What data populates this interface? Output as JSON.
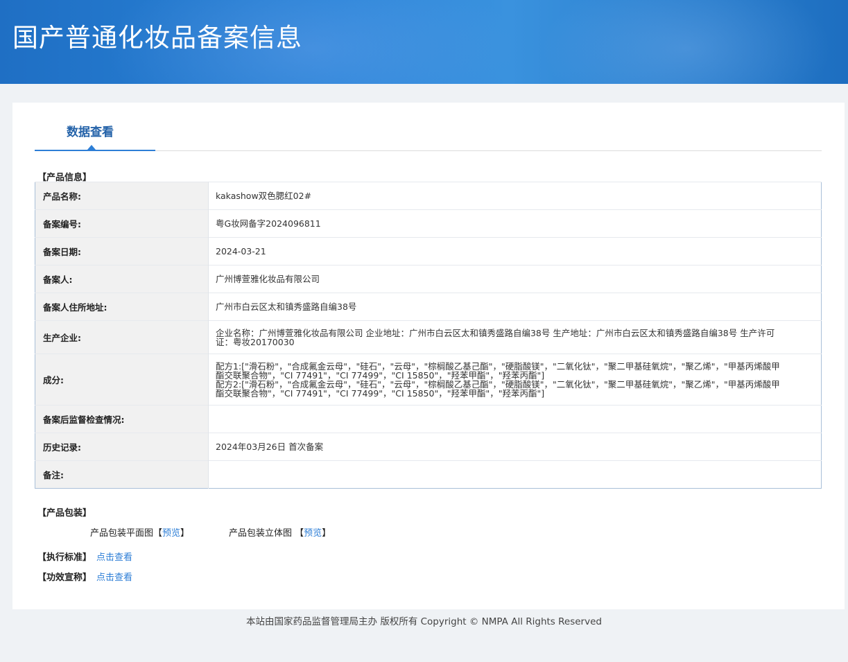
{
  "header": {
    "title": "国产普通化妆品备案信息"
  },
  "tab": {
    "label": "数据查看"
  },
  "sections": {
    "product_info": "【产品信息】",
    "packaging": "【产品包装】",
    "standard": "【执行标准】",
    "efficacy": "【功效宣称】"
  },
  "rows": [
    {
      "label": "产品名称:",
      "value": "kakashow双色腮红02#"
    },
    {
      "label": "备案编号:",
      "value": "粤G妆网备字2024096811"
    },
    {
      "label": "备案日期:",
      "value": "2024-03-21"
    },
    {
      "label": "备案人:",
      "value": "广州博萱雅化妆品有限公司"
    },
    {
      "label": "备案人住所地址:",
      "value": "广州市白云区太和镇秀盛路自编38号"
    },
    {
      "label": "生产企业:",
      "value": "企业名称：广州博萱雅化妆品有限公司 企业地址：广州市白云区太和镇秀盛路自编38号 生产地址：广州市白云区太和镇秀盛路自编38号 生产许可证：粤妆20170030"
    },
    {
      "label": "成分:",
      "value_lines": [
        "配方1:[\"滑石粉\"，\"合成氟金云母\"，\"硅石\"，\"云母\"，\"棕榈酸乙基己酯\"，\"硬脂酸镁\"，\"二氧化钛\"，\"聚二甲基硅氧烷\"，\"聚乙烯\"，\"甲基丙烯酸甲酯交联聚合物\"，\"CI 77491\"，\"CI 77499\"，\"CI 15850\"，\"羟苯甲酯\"，\"羟苯丙酯\"]",
        "配方2:[\"滑石粉\"，\"合成氟金云母\"，\"硅石\"，\"云母\"，\"棕榈酸乙基己酯\"，\"硬脂酸镁\"，\"二氧化钛\"，\"聚二甲基硅氧烷\"，\"聚乙烯\"，\"甲基丙烯酸甲酯交联聚合物\"，\"CI 77491\"，\"CI 77499\"，\"CI 15850\"，\"羟苯甲酯\"，\"羟苯丙酯\"]"
      ]
    },
    {
      "label": "备案后监督检查情况:",
      "value": ""
    },
    {
      "label": "历史记录:",
      "value": "2024年03月26日 首次备案"
    },
    {
      "label": "备注:",
      "value": ""
    }
  ],
  "packaging": {
    "flat_label": "产品包装平面图",
    "flat_link": "预览",
    "solid_label": "产品包装立体图",
    "solid_link": "预览",
    "bracket_open": "【",
    "bracket_close": "】"
  },
  "links": {
    "view": "点击查看"
  },
  "footer": {
    "text": "本站由国家药品监督管理局主办 版权所有 Copyright © NMPA All Rights Reserved"
  }
}
